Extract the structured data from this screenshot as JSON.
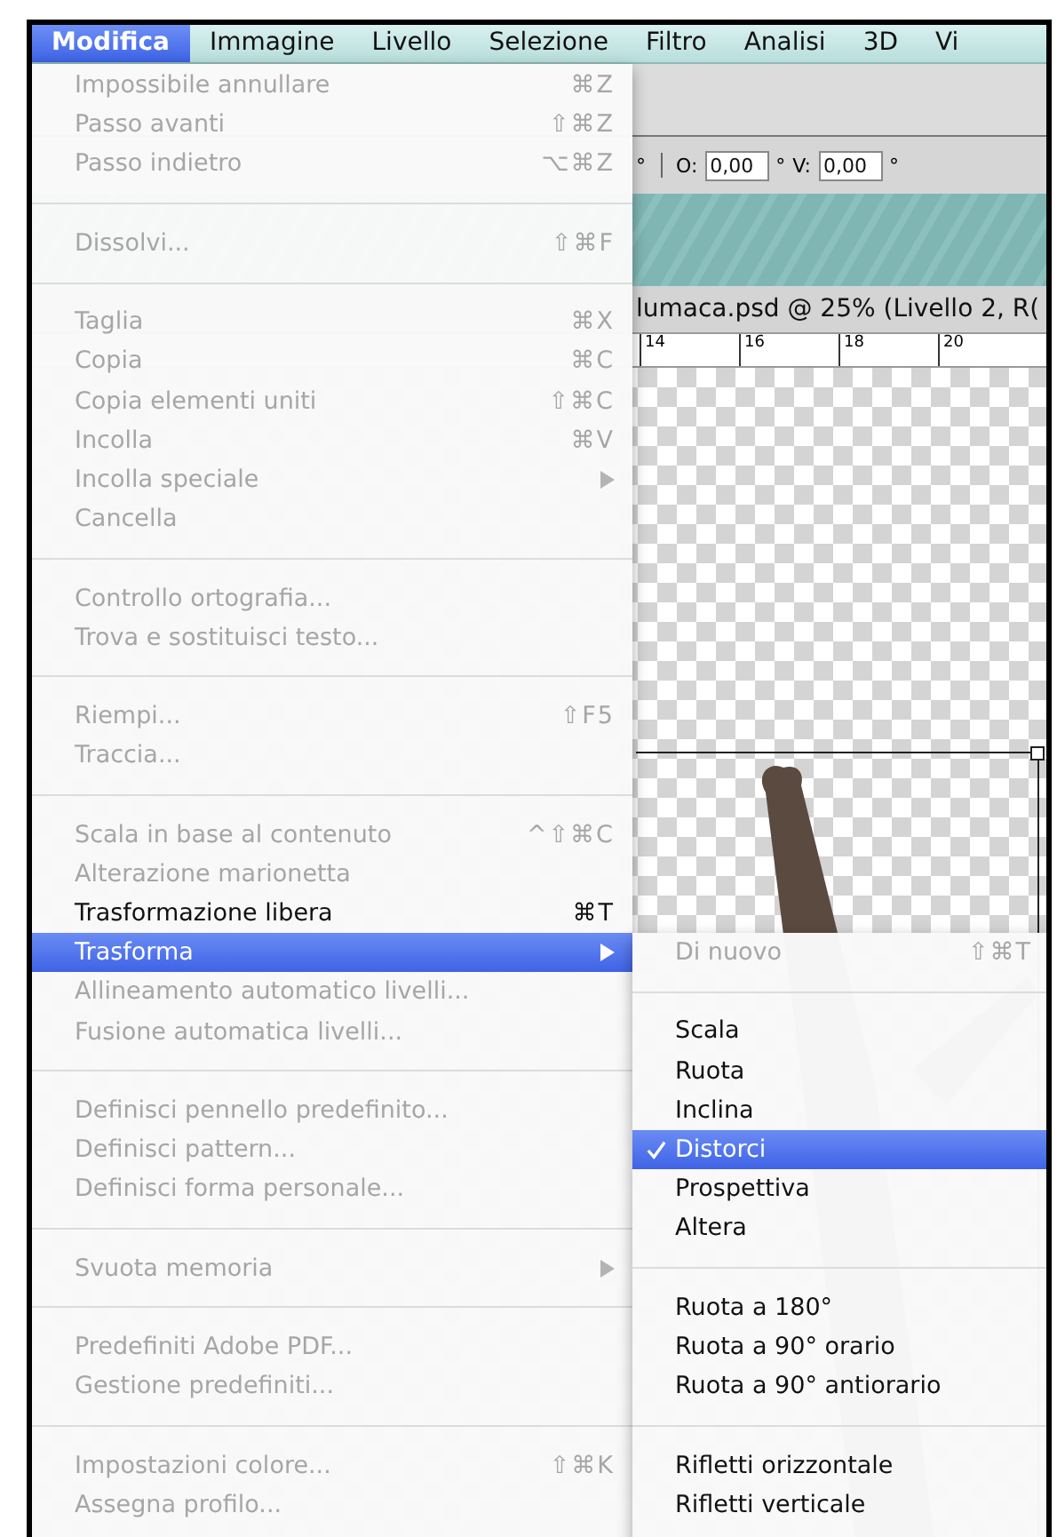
{
  "menubar": [
    {
      "label": "Modifica",
      "selected": true
    },
    {
      "label": "Immagine",
      "selected": false
    },
    {
      "label": "Livello",
      "selected": false
    },
    {
      "label": "Selezione",
      "selected": false
    },
    {
      "label": "Filtro",
      "selected": false
    },
    {
      "label": "Analisi",
      "selected": false
    },
    {
      "label": "3D",
      "selected": false
    },
    {
      "label": "Vi",
      "selected": false
    }
  ],
  "options_bar": {
    "leading_unit": "°",
    "fields": [
      {
        "label": "O:",
        "value": "0,00",
        "unit": "°"
      },
      {
        "label": "V:",
        "value": "0,00",
        "unit": "°"
      }
    ]
  },
  "document": {
    "title": "lumaca.psd @ 25% (Livello 2, R(",
    "ruler_labels": [
      "14",
      "16",
      "18",
      "20"
    ]
  },
  "edit_menu": [
    {
      "kind": "item",
      "label": "Impossibile annullare",
      "shortcut": "⌘Z",
      "disabled": true,
      "submenu": false,
      "selected": false
    },
    {
      "kind": "item",
      "label": "Passo avanti",
      "shortcut": "⇧⌘Z",
      "disabled": true,
      "submenu": false,
      "selected": false
    },
    {
      "kind": "item",
      "label": "Passo indietro",
      "shortcut": "⌥⌘Z",
      "disabled": true,
      "submenu": false,
      "selected": false
    },
    {
      "kind": "separator"
    },
    {
      "kind": "item",
      "label": "Dissolvi...",
      "shortcut": "⇧⌘F",
      "disabled": true,
      "submenu": false,
      "selected": false
    },
    {
      "kind": "separator"
    },
    {
      "kind": "item",
      "label": "Taglia",
      "shortcut": "⌘X",
      "disabled": true,
      "submenu": false,
      "selected": false
    },
    {
      "kind": "item",
      "label": "Copia",
      "shortcut": "⌘C",
      "disabled": true,
      "submenu": false,
      "selected": false
    },
    {
      "kind": "item",
      "label": "Copia elementi uniti",
      "shortcut": "⇧⌘C",
      "disabled": true,
      "submenu": false,
      "selected": false
    },
    {
      "kind": "item",
      "label": "Incolla",
      "shortcut": "⌘V",
      "disabled": true,
      "submenu": false,
      "selected": false
    },
    {
      "kind": "item",
      "label": "Incolla speciale",
      "disabled": true,
      "submenu": true,
      "selected": false
    },
    {
      "kind": "item",
      "label": "Cancella",
      "disabled": true,
      "submenu": false,
      "selected": false
    },
    {
      "kind": "separator"
    },
    {
      "kind": "item",
      "label": "Controllo ortografia...",
      "disabled": true,
      "submenu": false,
      "selected": false
    },
    {
      "kind": "item",
      "label": "Trova e sostituisci testo...",
      "disabled": true,
      "submenu": false,
      "selected": false
    },
    {
      "kind": "separator"
    },
    {
      "kind": "item",
      "label": "Riempi...",
      "shortcut": "⇧F5",
      "disabled": true,
      "submenu": false,
      "selected": false
    },
    {
      "kind": "item",
      "label": "Traccia...",
      "disabled": true,
      "submenu": false,
      "selected": false
    },
    {
      "kind": "separator"
    },
    {
      "kind": "item",
      "label": "Scala in base al contenuto",
      "shortcut": "^⇧⌘C",
      "disabled": true,
      "submenu": false,
      "selected": false
    },
    {
      "kind": "item",
      "label": "Alterazione marionetta",
      "disabled": true,
      "submenu": false,
      "selected": false
    },
    {
      "kind": "item",
      "label": "Trasformazione libera",
      "shortcut": "⌘T",
      "disabled": false,
      "submenu": false,
      "selected": false
    },
    {
      "kind": "item",
      "label": "Trasforma",
      "disabled": false,
      "submenu": true,
      "selected": true
    },
    {
      "kind": "item",
      "label": "Allineamento automatico livelli...",
      "disabled": true,
      "submenu": false,
      "selected": false
    },
    {
      "kind": "item",
      "label": "Fusione automatica livelli...",
      "disabled": true,
      "submenu": false,
      "selected": false
    },
    {
      "kind": "separator"
    },
    {
      "kind": "item",
      "label": "Definisci pennello predefinito...",
      "disabled": true,
      "submenu": false,
      "selected": false
    },
    {
      "kind": "item",
      "label": "Definisci pattern...",
      "disabled": true,
      "submenu": false,
      "selected": false
    },
    {
      "kind": "item",
      "label": "Definisci forma personale...",
      "disabled": true,
      "submenu": false,
      "selected": false
    },
    {
      "kind": "separator"
    },
    {
      "kind": "item",
      "label": "Svuota memoria",
      "disabled": true,
      "submenu": true,
      "selected": false
    },
    {
      "kind": "separator"
    },
    {
      "kind": "item",
      "label": "Predefiniti Adobe PDF...",
      "disabled": true,
      "submenu": false,
      "selected": false
    },
    {
      "kind": "item",
      "label": "Gestione predefiniti...",
      "disabled": true,
      "submenu": false,
      "selected": false
    },
    {
      "kind": "separator"
    },
    {
      "kind": "item",
      "label": "Impostazioni colore...",
      "shortcut": "⇧⌘K",
      "disabled": true,
      "submenu": false,
      "selected": false
    },
    {
      "kind": "item",
      "label": "Assegna profilo...",
      "disabled": true,
      "submenu": false,
      "selected": false
    }
  ],
  "transform_submenu": [
    {
      "kind": "item",
      "label": "Di nuovo",
      "shortcut": "⇧⌘T",
      "disabled": true,
      "checked": false,
      "selected": false
    },
    {
      "kind": "separator"
    },
    {
      "kind": "item",
      "label": "Scala",
      "disabled": false,
      "checked": false,
      "selected": false
    },
    {
      "kind": "item",
      "label": "Ruota",
      "disabled": false,
      "checked": false,
      "selected": false
    },
    {
      "kind": "item",
      "label": "Inclina",
      "disabled": false,
      "checked": false,
      "selected": false
    },
    {
      "kind": "item",
      "label": "Distorci",
      "disabled": false,
      "checked": true,
      "selected": true
    },
    {
      "kind": "item",
      "label": "Prospettiva",
      "disabled": false,
      "checked": false,
      "selected": false
    },
    {
      "kind": "item",
      "label": "Altera",
      "disabled": false,
      "checked": false,
      "selected": false
    },
    {
      "kind": "separator"
    },
    {
      "kind": "item",
      "label": "Ruota a 180°",
      "disabled": false,
      "checked": false,
      "selected": false
    },
    {
      "kind": "item",
      "label": "Ruota a 90° orario",
      "disabled": false,
      "checked": false,
      "selected": false
    },
    {
      "kind": "item",
      "label": "Ruota a 90° antiorario",
      "disabled": false,
      "checked": false,
      "selected": false
    },
    {
      "kind": "separator"
    },
    {
      "kind": "item",
      "label": "Rifletti orizzontale",
      "disabled": false,
      "checked": false,
      "selected": false
    },
    {
      "kind": "item",
      "label": "Rifletti verticale",
      "disabled": false,
      "checked": false,
      "selected": false
    }
  ]
}
